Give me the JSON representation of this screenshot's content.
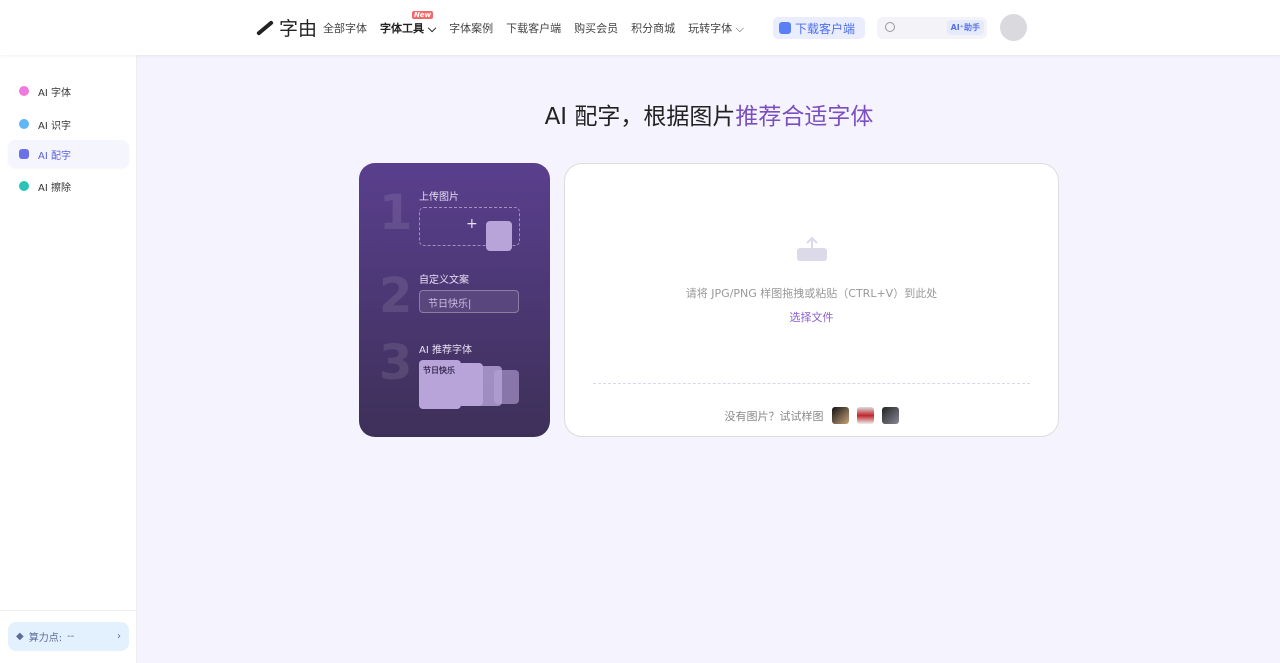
{
  "header": {
    "logo": "字由",
    "nav": [
      {
        "label": "全部字体"
      },
      {
        "label": "字体工具",
        "badge": "New",
        "dropdown": true
      },
      {
        "label": "字体案例"
      },
      {
        "label": "下载客户端"
      },
      {
        "label": "购买会员"
      },
      {
        "label": "积分商城"
      },
      {
        "label": "玩转字体",
        "dropdown": true
      }
    ],
    "download_button": "下载客户端",
    "search_placeholder": "",
    "ai_assistant": "AI⁺助手"
  },
  "sidebar": {
    "items": [
      {
        "label": "AI 字体",
        "color": "#f07be0"
      },
      {
        "label": "AI 识字",
        "color": "#5fb7f5"
      },
      {
        "label": "AI 配字",
        "color": "#6b6fe8",
        "active": true
      },
      {
        "label": "AI 擦除",
        "color": "#2bc4b4"
      }
    ],
    "points_label": "算力点:",
    "points_value": "--"
  },
  "main": {
    "title_prefix": "AI 配字，根据图片",
    "title_highlight": "推荐合适字体",
    "steps": {
      "n1": "1",
      "n2": "2",
      "n3": "3",
      "step1": "上传图片",
      "step2": "自定义文案",
      "step2_value": "节日快乐|",
      "step3": "AI 推荐字体",
      "preview_text": "节日快乐"
    },
    "upload": {
      "hint": "请将 JPG/PNG 样图拖拽或粘贴（CTRL+V）到此处",
      "choose": "选择文件",
      "samples_label": "没有图片？试试样图"
    }
  }
}
